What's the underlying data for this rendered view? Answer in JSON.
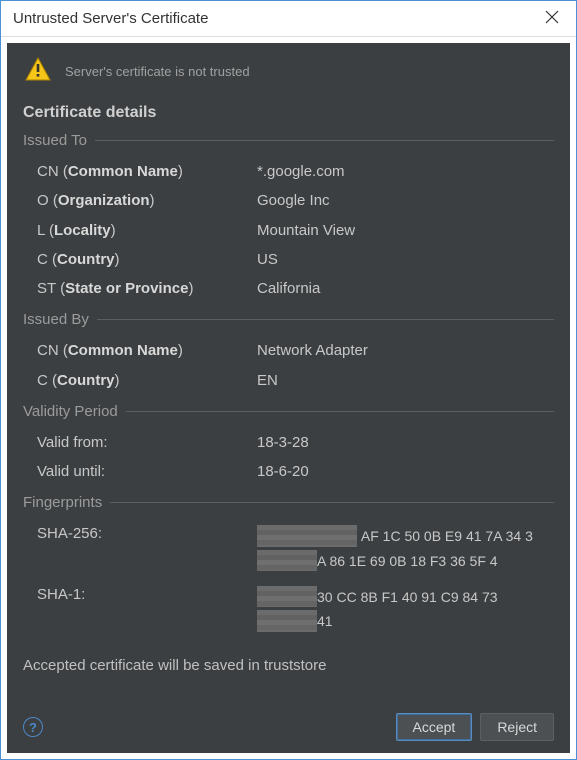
{
  "window": {
    "title": "Untrusted Server's Certificate"
  },
  "warning": {
    "text": "Server's certificate is not trusted"
  },
  "details": {
    "title": "Certificate details"
  },
  "sections": {
    "issued_to": {
      "title": "Issued To",
      "rows": {
        "cn": {
          "label_prefix": "CN (",
          "label_bold": "Common Name",
          "label_suffix": ")",
          "value": "*.google.com"
        },
        "o": {
          "label_prefix": "O (",
          "label_bold": "Organization",
          "label_suffix": ")",
          "value": "Google Inc"
        },
        "l": {
          "label_prefix": "L (",
          "label_bold": "Locality",
          "label_suffix": ")",
          "value": "Mountain View"
        },
        "c": {
          "label_prefix": "C (",
          "label_bold": "Country",
          "label_suffix": ")",
          "value": "US"
        },
        "st": {
          "label_prefix": "ST (",
          "label_bold": "State or Province",
          "label_suffix": ")",
          "value": "California"
        }
      }
    },
    "issued_by": {
      "title": "Issued By",
      "rows": {
        "cn": {
          "label_prefix": "CN (",
          "label_bold": "Common Name",
          "label_suffix": ")",
          "value": "Network Adapter"
        },
        "c": {
          "label_prefix": "C (",
          "label_bold": "Country",
          "label_suffix": ")",
          "value": "EN"
        }
      }
    },
    "validity": {
      "title": "Validity Period",
      "rows": {
        "from": {
          "label": "Valid from:",
          "value": "18-3-28"
        },
        "until": {
          "label": "Valid until:",
          "value": "18-6-20"
        }
      }
    },
    "fingerprints": {
      "title": "Fingerprints",
      "sha256": {
        "label": "SHA-256:",
        "line1_visible": " AF 1C 50 0B E9 41 7A 34 3",
        "line2_visible": "A 86 1E 69 0B 18 F3 36 5F 4"
      },
      "sha1": {
        "label": "SHA-1:",
        "line1_visible": "30 CC 8B F1 40 91 C9 84 73",
        "line2_visible": "41"
      }
    }
  },
  "truststore_note": "Accepted certificate will be saved in truststore",
  "buttons": {
    "accept": "Accept",
    "reject": "Reject"
  }
}
